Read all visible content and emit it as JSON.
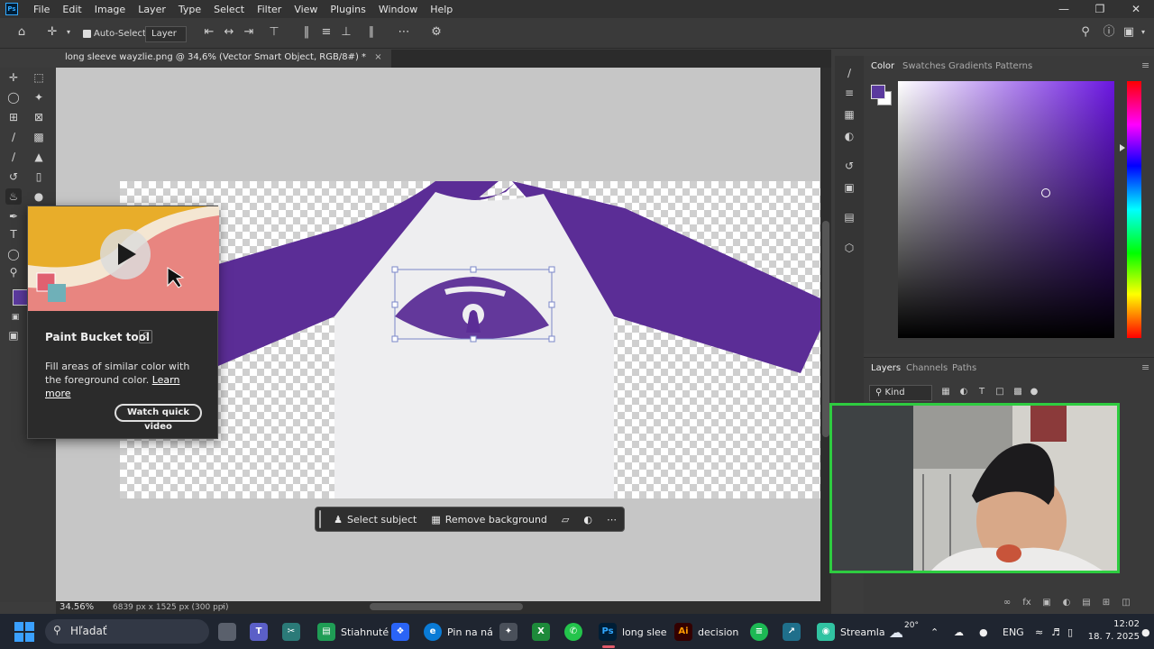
{
  "menu": [
    "File",
    "Edit",
    "Image",
    "Layer",
    "Type",
    "Select",
    "Filter",
    "View",
    "Plugins",
    "Window",
    "Help"
  ],
  "app_logo": "Ps",
  "options": {
    "auto_select_label": "Auto-Select:",
    "layer_select_value": "Layer"
  },
  "document": {
    "tab_title": "long sleeve wayzlie.png @ 34,6% (Vector Smart Object, RGB/8#) *",
    "zoom": "34.56%",
    "dimensions": "6839 px x 1525 px (300 ppi)"
  },
  "tooltip": {
    "title": "Paint Bucket tool",
    "shortcut": "G",
    "description": "Fill areas of similar color with the foreground color.",
    "learn_more": "Learn more",
    "video_button": "Watch quick video"
  },
  "context_bar": {
    "select_subject": "Select subject",
    "remove_background": "Remove background"
  },
  "color_panel": {
    "tabs": [
      "Color",
      "Swatches",
      "Gradients",
      "Patterns"
    ],
    "foreground_color": "#5b3a9e",
    "background_color": "#ffffff"
  },
  "layers_panel": {
    "tabs": [
      "Layers",
      "Channels",
      "Paths"
    ],
    "kind_filter": "Kind"
  },
  "shirt_colors": {
    "sleeves": "#5b2d96",
    "body": "#eeeef0",
    "graphic": "#5b2d96"
  },
  "taskbar": {
    "search_placeholder": "Hľadať",
    "apps": [
      {
        "label": "Stiahnuté"
      },
      {
        "label": "Pin na ná"
      },
      {
        "label": "long slee"
      },
      {
        "label": "decision"
      },
      {
        "label": "Streamla"
      }
    ],
    "weather": "20°",
    "language": "ENG",
    "time": "12:02",
    "date": "18. 7. 2025"
  }
}
